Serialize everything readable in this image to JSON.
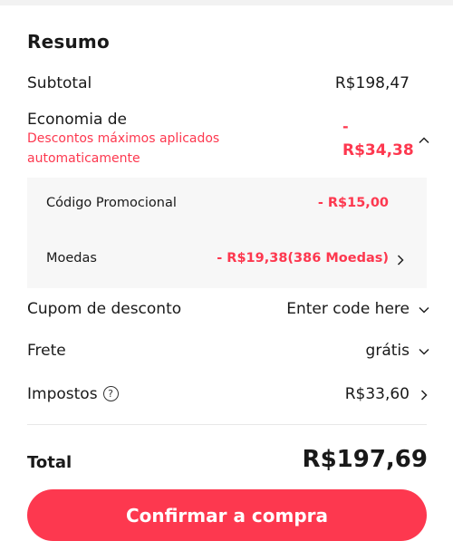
{
  "summary": {
    "title": "Resumo",
    "subtotal_label": "Subtotal",
    "subtotal_value": "R$198,47",
    "savings_label": "Economia de",
    "savings_note": "Descontos máximos aplicados automaticamente",
    "savings_value_prefix": "-",
    "savings_value": "R$34,38",
    "promo_label": "Código Promocional",
    "promo_value": "- R$15,00",
    "coins_label": "Moedas",
    "coins_value": "- R$19,38(386 Moedas)",
    "coupon_label": "Cupom de desconto",
    "coupon_value": "Enter code here",
    "shipping_label": "Frete",
    "shipping_value": "grátis",
    "taxes_label": "Impostos",
    "taxes_help": "?",
    "taxes_value": "R$33,60",
    "total_label": "Total",
    "total_value": "R$197,69",
    "confirm_label": "Confirmar a compra"
  },
  "colors": {
    "accent": "#fd384f",
    "text": "#191919",
    "box_bg": "#f7f7f7"
  },
  "icons": {
    "savings_toggle": "chevron-up-icon",
    "coins_arrow": "chevron-right-icon",
    "coupon_arrow": "chevron-down-icon",
    "shipping_arrow": "chevron-down-icon",
    "taxes_arrow": "chevron-right-icon",
    "taxes_help": "help-circle-icon"
  }
}
